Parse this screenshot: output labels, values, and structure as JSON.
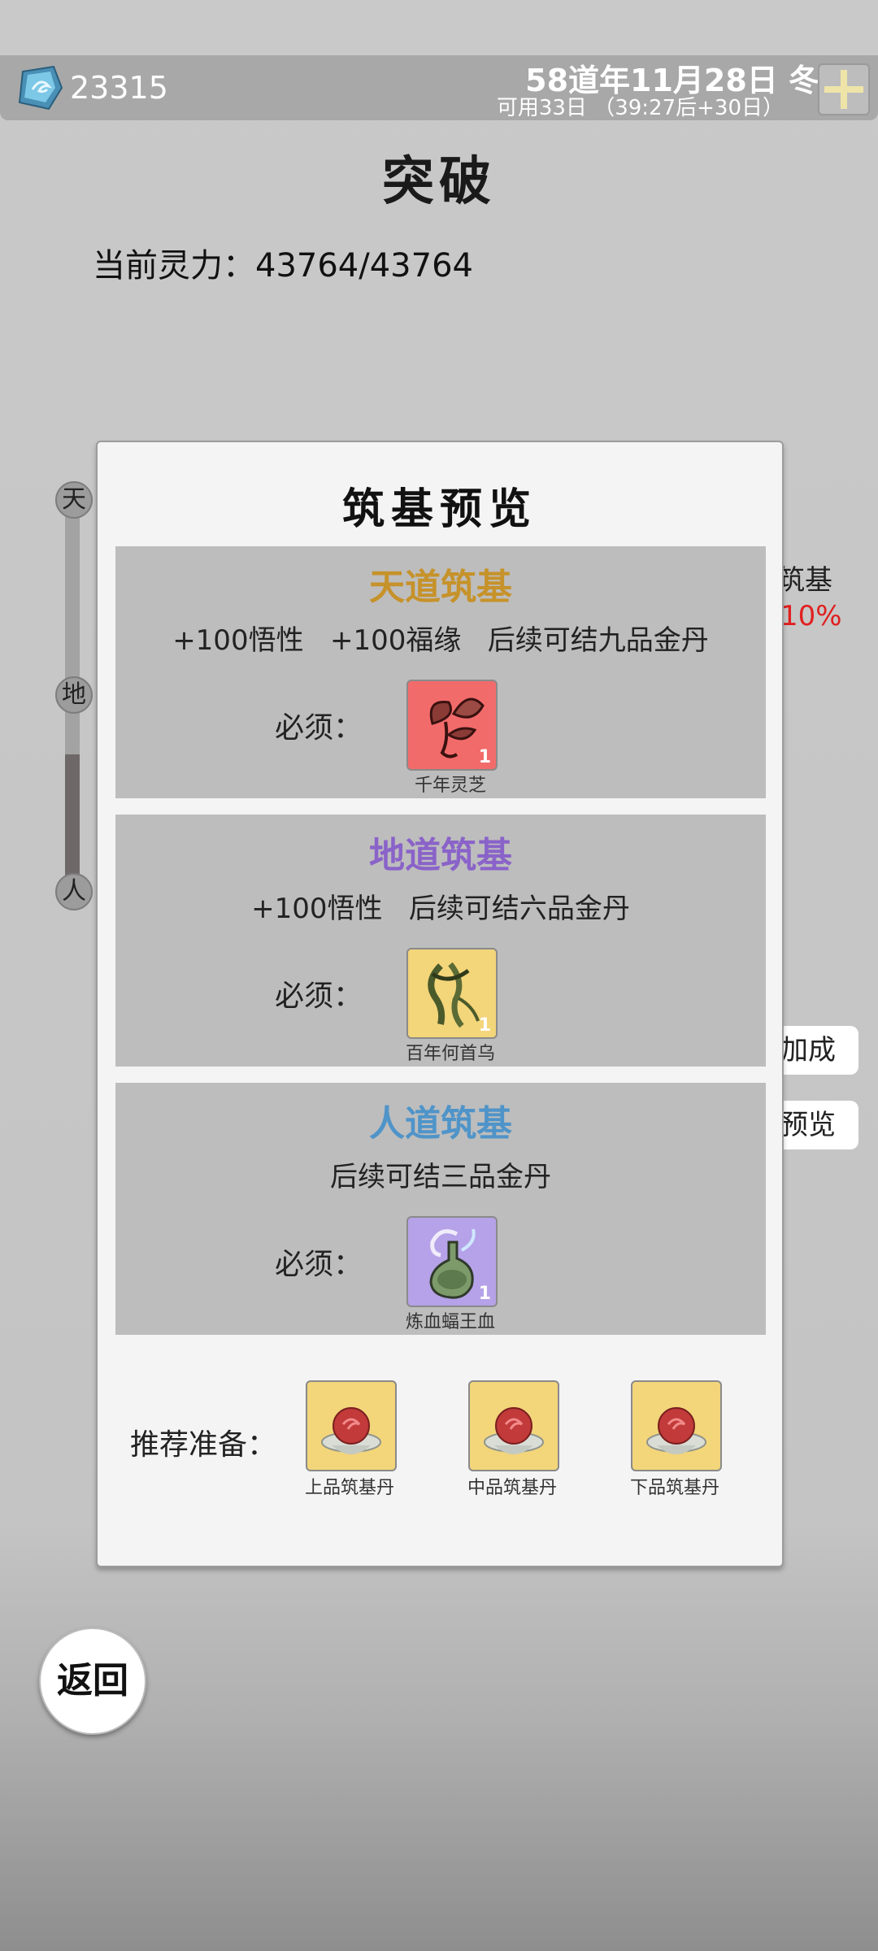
{
  "header": {
    "gem_icon": "spirit-stone-icon",
    "gem_count": "23315",
    "date": "58道年11月28日 冬",
    "availability": "可用33日 （39:27后+30日）",
    "plus_icon": "plus-icon"
  },
  "page": {
    "title": "突破",
    "spirit_power": "当前灵力：43764/43764"
  },
  "background": {
    "partial_text1": "筑基",
    "partial_text2": "10%",
    "bonus_button": "加成",
    "preview_button": "预览"
  },
  "slider": {
    "nodes": [
      "天",
      "地",
      "人"
    ],
    "level_fraction": 0.33
  },
  "popup": {
    "title": "筑基预览",
    "cards": [
      {
        "title": "天道筑基",
        "title_color": "#c6922a",
        "desc": "+100悟性   +100福缘   后续可结九品金丹",
        "required_label": "必须：",
        "item_name": "千年灵芝",
        "item_count": "1",
        "item_icon": "lingzhi-icon",
        "item_bg": "#f26b6b"
      },
      {
        "title": "地道筑基",
        "title_color": "#8a63c9",
        "desc": "+100悟性   后续可结六品金丹",
        "required_label": "必须：",
        "item_name": "百年何首乌",
        "item_count": "1",
        "item_icon": "heshouwu-icon",
        "item_bg": "#f3d57a"
      },
      {
        "title": "人道筑基",
        "title_color": "#4f94c9",
        "desc": "后续可结三品金丹",
        "required_label": "必须：",
        "item_name": "炼血蝠王血",
        "item_count": "1",
        "item_icon": "blood-vial-icon",
        "item_bg": "#b5a2e8"
      }
    ],
    "recommended_label": "推荐准备：",
    "recommended": [
      {
        "name": "上品筑基丹",
        "icon": "pill-icon"
      },
      {
        "name": "中品筑基丹",
        "icon": "pill-icon"
      },
      {
        "name": "下品筑基丹",
        "icon": "pill-icon"
      }
    ]
  },
  "back_button": "返回"
}
